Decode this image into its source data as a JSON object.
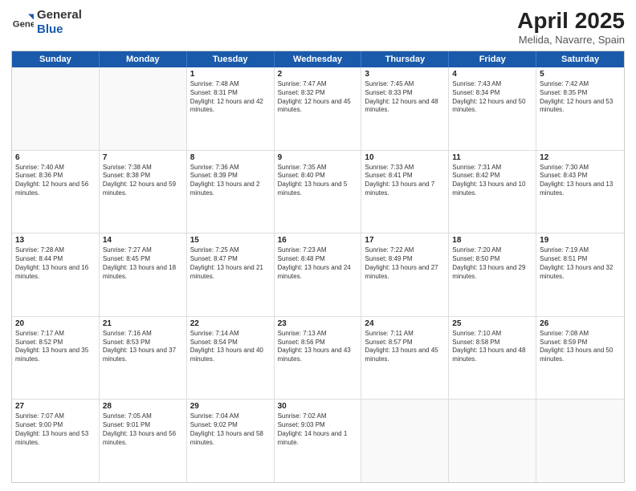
{
  "header": {
    "logo_general": "General",
    "logo_blue": "Blue",
    "month_year": "April 2025",
    "location": "Melida, Navarre, Spain"
  },
  "weekdays": [
    "Sunday",
    "Monday",
    "Tuesday",
    "Wednesday",
    "Thursday",
    "Friday",
    "Saturday"
  ],
  "rows": [
    [
      {
        "day": "",
        "text": ""
      },
      {
        "day": "",
        "text": ""
      },
      {
        "day": "1",
        "text": "Sunrise: 7:48 AM\nSunset: 8:31 PM\nDaylight: 12 hours and 42 minutes."
      },
      {
        "day": "2",
        "text": "Sunrise: 7:47 AM\nSunset: 8:32 PM\nDaylight: 12 hours and 45 minutes."
      },
      {
        "day": "3",
        "text": "Sunrise: 7:45 AM\nSunset: 8:33 PM\nDaylight: 12 hours and 48 minutes."
      },
      {
        "day": "4",
        "text": "Sunrise: 7:43 AM\nSunset: 8:34 PM\nDaylight: 12 hours and 50 minutes."
      },
      {
        "day": "5",
        "text": "Sunrise: 7:42 AM\nSunset: 8:35 PM\nDaylight: 12 hours and 53 minutes."
      }
    ],
    [
      {
        "day": "6",
        "text": "Sunrise: 7:40 AM\nSunset: 8:36 PM\nDaylight: 12 hours and 56 minutes."
      },
      {
        "day": "7",
        "text": "Sunrise: 7:38 AM\nSunset: 8:38 PM\nDaylight: 12 hours and 59 minutes."
      },
      {
        "day": "8",
        "text": "Sunrise: 7:36 AM\nSunset: 8:39 PM\nDaylight: 13 hours and 2 minutes."
      },
      {
        "day": "9",
        "text": "Sunrise: 7:35 AM\nSunset: 8:40 PM\nDaylight: 13 hours and 5 minutes."
      },
      {
        "day": "10",
        "text": "Sunrise: 7:33 AM\nSunset: 8:41 PM\nDaylight: 13 hours and 7 minutes."
      },
      {
        "day": "11",
        "text": "Sunrise: 7:31 AM\nSunset: 8:42 PM\nDaylight: 13 hours and 10 minutes."
      },
      {
        "day": "12",
        "text": "Sunrise: 7:30 AM\nSunset: 8:43 PM\nDaylight: 13 hours and 13 minutes."
      }
    ],
    [
      {
        "day": "13",
        "text": "Sunrise: 7:28 AM\nSunset: 8:44 PM\nDaylight: 13 hours and 16 minutes."
      },
      {
        "day": "14",
        "text": "Sunrise: 7:27 AM\nSunset: 8:45 PM\nDaylight: 13 hours and 18 minutes."
      },
      {
        "day": "15",
        "text": "Sunrise: 7:25 AM\nSunset: 8:47 PM\nDaylight: 13 hours and 21 minutes."
      },
      {
        "day": "16",
        "text": "Sunrise: 7:23 AM\nSunset: 8:48 PM\nDaylight: 13 hours and 24 minutes."
      },
      {
        "day": "17",
        "text": "Sunrise: 7:22 AM\nSunset: 8:49 PM\nDaylight: 13 hours and 27 minutes."
      },
      {
        "day": "18",
        "text": "Sunrise: 7:20 AM\nSunset: 8:50 PM\nDaylight: 13 hours and 29 minutes."
      },
      {
        "day": "19",
        "text": "Sunrise: 7:19 AM\nSunset: 8:51 PM\nDaylight: 13 hours and 32 minutes."
      }
    ],
    [
      {
        "day": "20",
        "text": "Sunrise: 7:17 AM\nSunset: 8:52 PM\nDaylight: 13 hours and 35 minutes."
      },
      {
        "day": "21",
        "text": "Sunrise: 7:16 AM\nSunset: 8:53 PM\nDaylight: 13 hours and 37 minutes."
      },
      {
        "day": "22",
        "text": "Sunrise: 7:14 AM\nSunset: 8:54 PM\nDaylight: 13 hours and 40 minutes."
      },
      {
        "day": "23",
        "text": "Sunrise: 7:13 AM\nSunset: 8:56 PM\nDaylight: 13 hours and 43 minutes."
      },
      {
        "day": "24",
        "text": "Sunrise: 7:11 AM\nSunset: 8:57 PM\nDaylight: 13 hours and 45 minutes."
      },
      {
        "day": "25",
        "text": "Sunrise: 7:10 AM\nSunset: 8:58 PM\nDaylight: 13 hours and 48 minutes."
      },
      {
        "day": "26",
        "text": "Sunrise: 7:08 AM\nSunset: 8:59 PM\nDaylight: 13 hours and 50 minutes."
      }
    ],
    [
      {
        "day": "27",
        "text": "Sunrise: 7:07 AM\nSunset: 9:00 PM\nDaylight: 13 hours and 53 minutes."
      },
      {
        "day": "28",
        "text": "Sunrise: 7:05 AM\nSunset: 9:01 PM\nDaylight: 13 hours and 56 minutes."
      },
      {
        "day": "29",
        "text": "Sunrise: 7:04 AM\nSunset: 9:02 PM\nDaylight: 13 hours and 58 minutes."
      },
      {
        "day": "30",
        "text": "Sunrise: 7:02 AM\nSunset: 9:03 PM\nDaylight: 14 hours and 1 minute."
      },
      {
        "day": "",
        "text": ""
      },
      {
        "day": "",
        "text": ""
      },
      {
        "day": "",
        "text": ""
      }
    ]
  ]
}
